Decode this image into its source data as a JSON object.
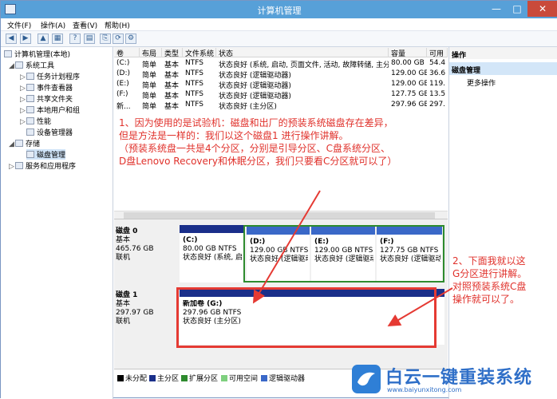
{
  "window": {
    "title": "计算机管理",
    "min": "—",
    "max": "□",
    "close": "✕"
  },
  "menu": [
    "文件(F)",
    "操作(A)",
    "查看(V)",
    "帮助(H)"
  ],
  "tree": {
    "root": "计算机管理(本地)",
    "system_tools": "系统工具",
    "task_scheduler": "任务计划程序",
    "event_viewer": "事件查看器",
    "shared_folders": "共享文件夹",
    "local_users": "本地用户和组",
    "performance": "性能",
    "device_manager": "设备管理器",
    "storage": "存储",
    "disk_management": "磁盘管理",
    "services": "服务和应用程序"
  },
  "volume_table": {
    "headers": [
      "卷",
      "布局",
      "类型",
      "文件系统",
      "状态",
      "容量",
      "可用"
    ],
    "rows": [
      [
        "(C:)",
        "简单",
        "基本",
        "NTFS",
        "状态良好 (系统, 启动, 页面文件, 活动, 故障转储, 主分区)",
        "80.00 GB",
        "54.4"
      ],
      [
        "(D:)",
        "简单",
        "基本",
        "NTFS",
        "状态良好 (逻辑驱动器)",
        "129.00 GB",
        "36.6"
      ],
      [
        "(E:)",
        "简单",
        "基本",
        "NTFS",
        "状态良好 (逻辑驱动器)",
        "129.00 GB",
        "119."
      ],
      [
        "(F:)",
        "简单",
        "基本",
        "NTFS",
        "状态良好 (逻辑驱动器)",
        "127.75 GB",
        "13.5"
      ],
      [
        "新...",
        "简单",
        "基本",
        "NTFS",
        "状态良好 (主分区)",
        "297.96 GB",
        "297."
      ]
    ]
  },
  "annotation_1": {
    "line1": "1、因为使用的是试验机：磁盘和出厂的预装系统磁盘存在差异，",
    "line2": "但是方法是一样的：我们以这个磁盘1 进行操作讲解。",
    "line3": "（预装系统盘一共是4个分区，分别是引导分区、C盘系统分区、",
    "line4": "D盘Lenovo Recovery和休眠分区，我们只要看C分区就可以了）"
  },
  "annotation_2": {
    "line1": "2、下面我就以这",
    "line2": "G分区进行讲解。",
    "line3": "对照预装系统C盘",
    "line4": "操作就可以了。"
  },
  "disk0": {
    "name": "磁盘 0",
    "type": "基本",
    "size": "465.76 GB",
    "status": "联机",
    "partitions": [
      {
        "label": "(C:)",
        "size": "80.00 GB NTFS",
        "status": "状态良好 (系统, 启"
      },
      {
        "label": "(D:)",
        "size": "129.00 GB NTFS",
        "status": "状态良好 (逻辑驱动"
      },
      {
        "label": "(E:)",
        "size": "129.00 GB NTFS",
        "status": "状态良好 (逻辑驱动"
      },
      {
        "label": "(F:)",
        "size": "127.75 GB NTFS",
        "status": "状态良好 (逻辑驱动"
      }
    ]
  },
  "disk1": {
    "name": "磁盘 1",
    "type": "基本",
    "size": "297.97 GB",
    "status": "联机",
    "partition": {
      "label": "新加卷  (G:)",
      "size": "297.96 GB NTFS",
      "status": "状态良好 (主分区)"
    }
  },
  "legend": [
    "未分配",
    "主分区",
    "扩展分区",
    "可用空间",
    "逻辑驱动器"
  ],
  "legend_colors": [
    "#000000",
    "#1a2f8a",
    "#2e8b2e",
    "#7fd07f",
    "#3a68c8"
  ],
  "actions": {
    "header": "操作",
    "section": "磁盘管理",
    "more": "更多操作"
  },
  "logo": {
    "text": "白云一键重装系统",
    "url": "www.baiyunxitong.com"
  },
  "colors": {
    "title_bar": "#57a0d8",
    "annotation": "#e0312b",
    "primary_partition": "#1a2f8a",
    "logical_drive": "#3a68c8",
    "extended_partition": "#2e8b2e"
  }
}
